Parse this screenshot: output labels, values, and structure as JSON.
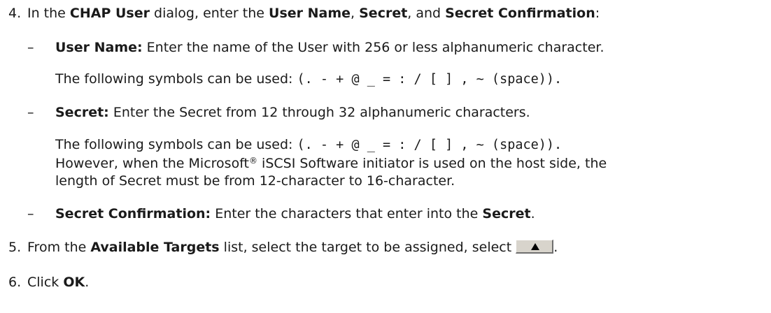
{
  "step4": {
    "number": "4.",
    "t1": "In the ",
    "b1": "CHAP User",
    "t2": " dialog, enter the ",
    "b2": "User Name",
    "t3": ", ",
    "b3": "Secret",
    "t4": ", and ",
    "b4": "Secret Confirmation",
    "t5": ":"
  },
  "dash": "–",
  "username": {
    "label": "User Name:",
    "text": " Enter the name of the User with 256 or less alphanumeric character.",
    "symbols_prefix": "The following symbols can be used: ",
    "symbols": "(. - + @ _ = : / [ ] , ~ (space))."
  },
  "secret": {
    "label": "Secret:",
    "text": " Enter the Secret from 12 through 32 alphanumeric characters.",
    "symbols_prefix": "The following symbols can be used: ",
    "symbols": "(. - + @ _ = : / [ ] , ~ (space)).",
    "note_a": "However, when the Microsoft",
    "note_reg": "®",
    "note_b": " iSCSI Software initiator is used on the host side, the",
    "note_line2": "length of Secret must be from 12-character to 16-character."
  },
  "confirm": {
    "label": "Secret Confirmation:",
    "text": " Enter the characters that enter into the ",
    "bold": "Secret",
    "end": "."
  },
  "step5": {
    "number": "5.",
    "t1": "From the ",
    "b1": "Available Targets",
    "t2": " list, select the target to be assigned, select ",
    "end": "."
  },
  "step6": {
    "number": "6.",
    "t1": "Click ",
    "b1": "OK",
    "t2": "."
  },
  "icons": {
    "move_up_button": "up-triangle-icon"
  }
}
